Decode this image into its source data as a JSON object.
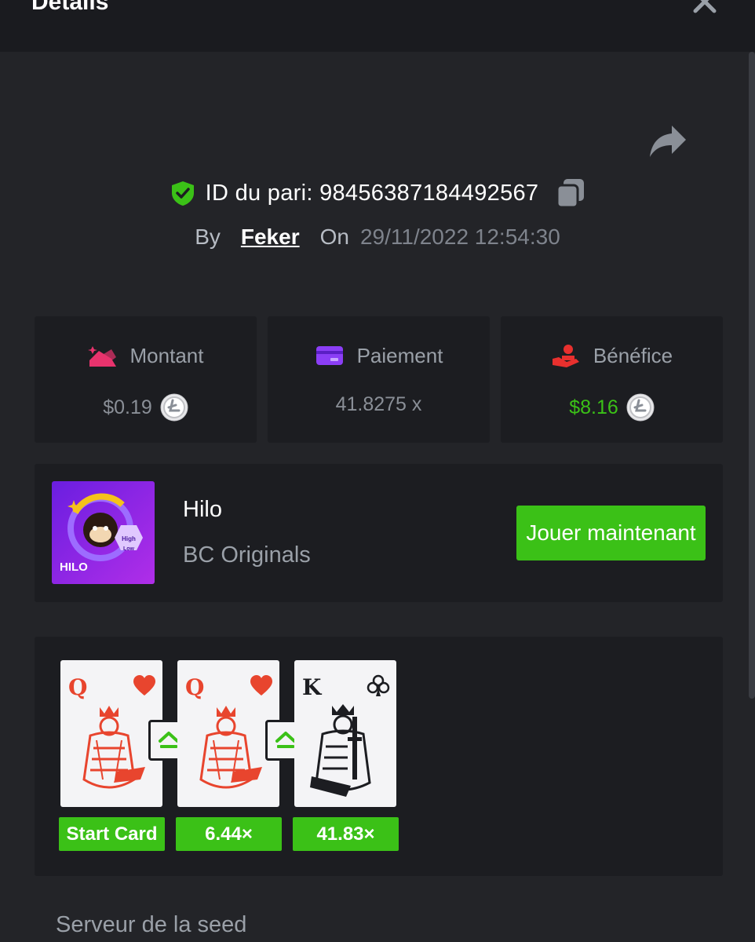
{
  "header": {
    "title": "Details"
  },
  "bet": {
    "id_text": "ID du pari: 98456387184492567",
    "by_label": "By",
    "username": "Feker",
    "on_label": "On",
    "date": "29/11/2022 12:54:30"
  },
  "stats": [
    {
      "label": "Montant",
      "value": "$0.19",
      "icon": "amount-icon",
      "color": "#e8336d"
    },
    {
      "label": "Paiement",
      "value": "41.8275 x",
      "icon": "payment-card-icon",
      "color": "#8b3ef6"
    },
    {
      "label": "Bénéfice",
      "value": "$8.16",
      "icon": "profit-hand-icon",
      "color": "#e8302e"
    }
  ],
  "game": {
    "name": "Hilo",
    "provider": "BC Originals",
    "play_label": "Jouer maintenant",
    "thumb_title": "HILO",
    "thumb_high": "High",
    "thumb_low": "Low"
  },
  "cards": [
    {
      "rank": "Q",
      "suit": "hearts",
      "suit_color": "#e8452e",
      "badge": "Start Card"
    },
    {
      "rank": "Q",
      "suit": "hearts",
      "suit_color": "#e8452e",
      "badge": "6.44×"
    },
    {
      "rank": "K",
      "suit": "clubs",
      "suit_color": "#1c1d21",
      "badge": "41.83×"
    }
  ],
  "seed": {
    "label": "Serveur de la seed"
  },
  "colors": {
    "accent_green": "#3bc117",
    "panel": "#1c1d21",
    "background": "#232428"
  }
}
